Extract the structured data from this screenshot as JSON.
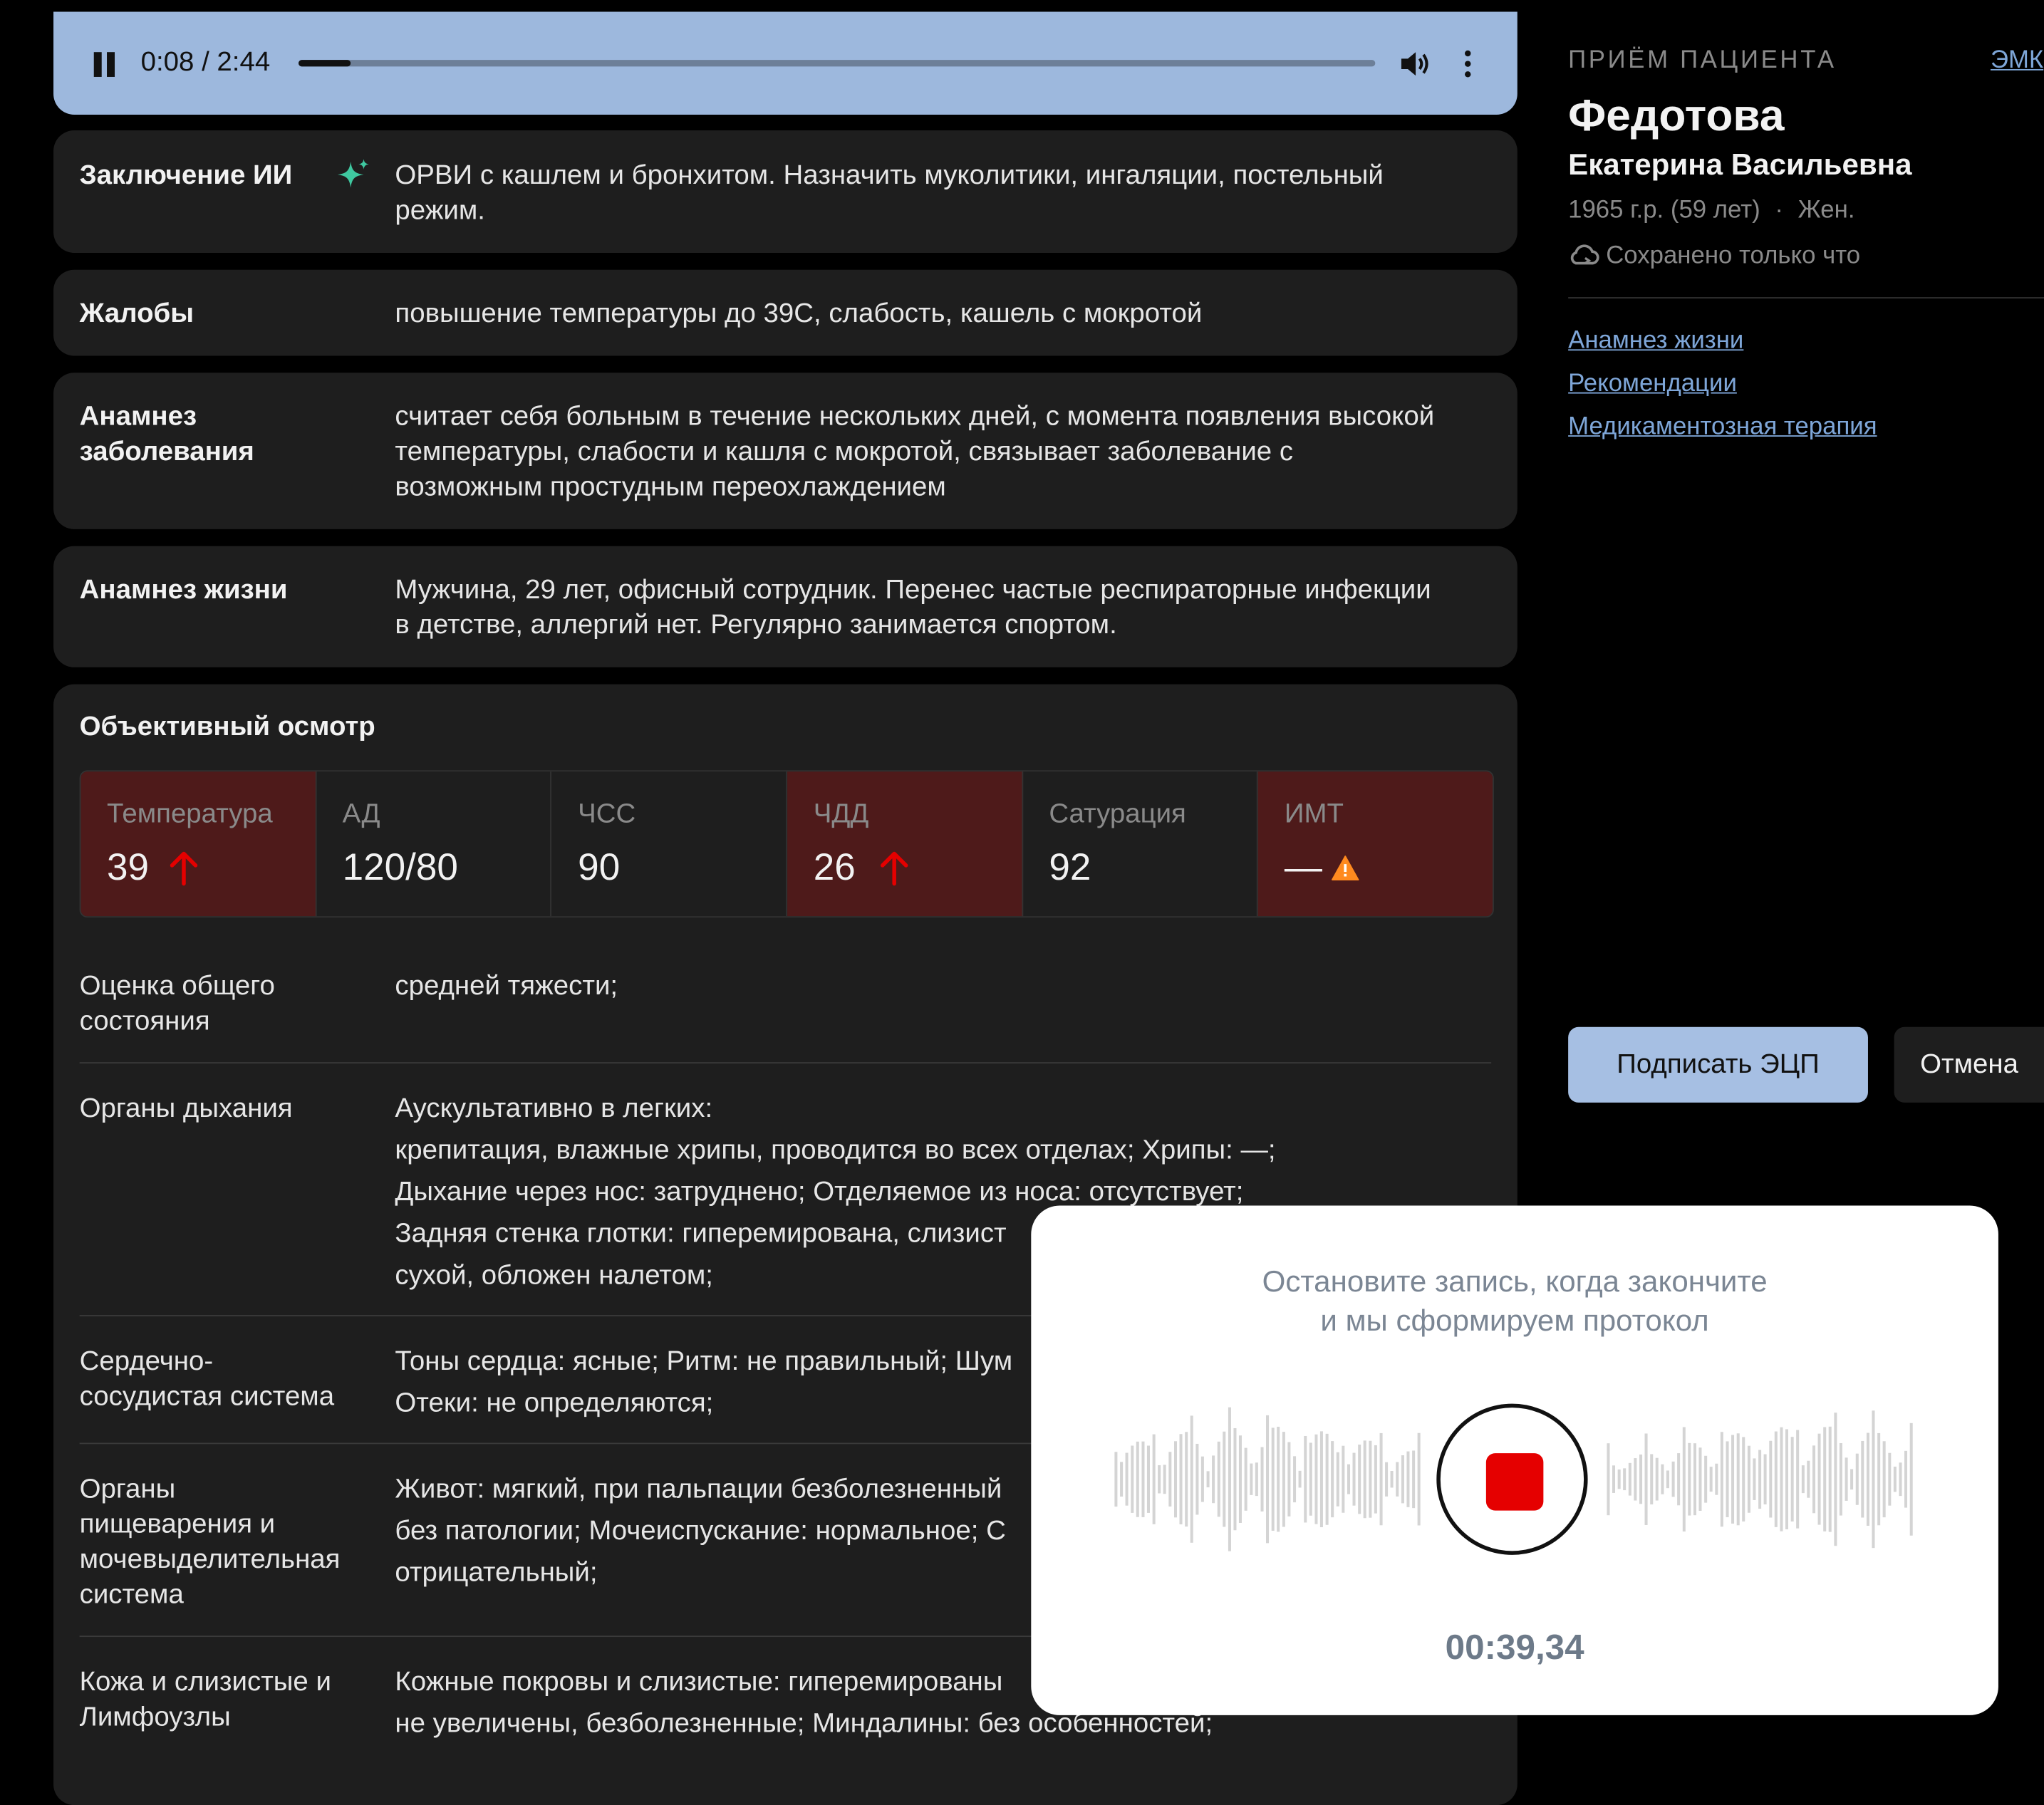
{
  "player": {
    "time": "0:08 / 2:44",
    "progress": 0.049
  },
  "sections": {
    "conclusion": {
      "label": "Заключение ИИ",
      "lines": [
        "ОРВИ с кашлем и бронхитом. Назначить муколитики, ингаляции, постельный",
        "режим."
      ]
    },
    "complaints": {
      "label": "Жалобы",
      "text": "повышение температуры до 39С, слабость, кашель с мокротой"
    },
    "history_disease": {
      "label_lines": [
        "Анамнез",
        "заболевания"
      ],
      "lines": [
        "считает себя больным в течение нескольких дней, с момента появления высокой",
        "температуры, слабости и кашля с мокротой, связывает заболевание с",
        "возможным простудным переохлаждением"
      ]
    },
    "history_life": {
      "label": "Анамнез жизни",
      "lines": [
        "Мужчина, 29 лет, офисный сотрудник. Перенес частые респираторные инфекции",
        "в детстве, аллергий нет. Регулярно занимается спортом."
      ]
    }
  },
  "exam": {
    "title": "Объективный осмотр",
    "vitals": [
      {
        "label": "Температура",
        "value": "39",
        "alert": true,
        "indicator": "arrow-up-icon"
      },
      {
        "label": "АД",
        "value": "120/80",
        "alert": false
      },
      {
        "label": "ЧСС",
        "value": "90",
        "alert": false
      },
      {
        "label": "ЧДД",
        "value": "26",
        "alert": true,
        "indicator": "arrow-up-icon"
      },
      {
        "label": "Сатурация",
        "value": "92",
        "alert": false
      },
      {
        "label": "ИМТ",
        "value": "—",
        "alert": true,
        "indicator": "warning-icon"
      }
    ],
    "rows": [
      {
        "label_lines": [
          "Оценка общего",
          "состояния"
        ],
        "lines": [
          "средней тяжести;"
        ]
      },
      {
        "label_lines": [
          "Органы дыхания"
        ],
        "lines": [
          "Аускультативно в легких:",
          "крепитация, влажные хрипы, проводится во всех отделах; Хрипы: —;",
          "Дыхание через нос: затруднено; Отделяемое из носа: отсутствует;",
          "Задняя стенка глотки: гиперемирована, слизист",
          "сухой, обложен налетом;"
        ]
      },
      {
        "label_lines": [
          "Сердечно-",
          "сосудистая система"
        ],
        "lines": [
          "Тоны сердца: ясные; Ритм: не правильный; Шум",
          "Отеки: не определяются;"
        ]
      },
      {
        "label_lines": [
          "Органы",
          "пищеварения и",
          "мочевыделительная",
          "система"
        ],
        "lines": [
          "Живот: мягкий, при пальпации безболезненный",
          "без патологии; Мочеиспускание: нормальное; С",
          "отрицательный;"
        ]
      },
      {
        "label_lines": [
          "Кожа и слизистые и",
          "Лимфоузлы"
        ],
        "lines": [
          "Кожные покровы и слизистые: гиперемированы",
          "не увеличены, безболезненные; Миндалины: без особенностей;"
        ]
      }
    ]
  },
  "patient": {
    "visit_label": "ПРИЁМ ПАЦИЕНТА",
    "emk_link": "ЭМК",
    "surname": "Федотова",
    "names": "Екатерина Васильевна",
    "birth_year": "1965 г.р. (59 лет)",
    "dot": "·",
    "gender": "Жен.",
    "saved_status": "Сохранено только что",
    "anchors": [
      "Анамнез жизни",
      "Рекомендации",
      "Медикаментозная терапия"
    ],
    "sign_button": "Подписать ЭЦП",
    "cancel_button": "Отмена"
  },
  "recording": {
    "hint_line1": "Остановите запись, когда закончите",
    "hint_line2": "и мы сформируем протокол",
    "timer": "00:39,34"
  },
  "colors": {
    "alert_bg": "#4e1a1a",
    "arrow": "#e50000",
    "warning": "#ff8a1f",
    "link": "#7ea6d8",
    "player_bg": "#9db8dd",
    "sparkle": "#3fc8a0"
  }
}
